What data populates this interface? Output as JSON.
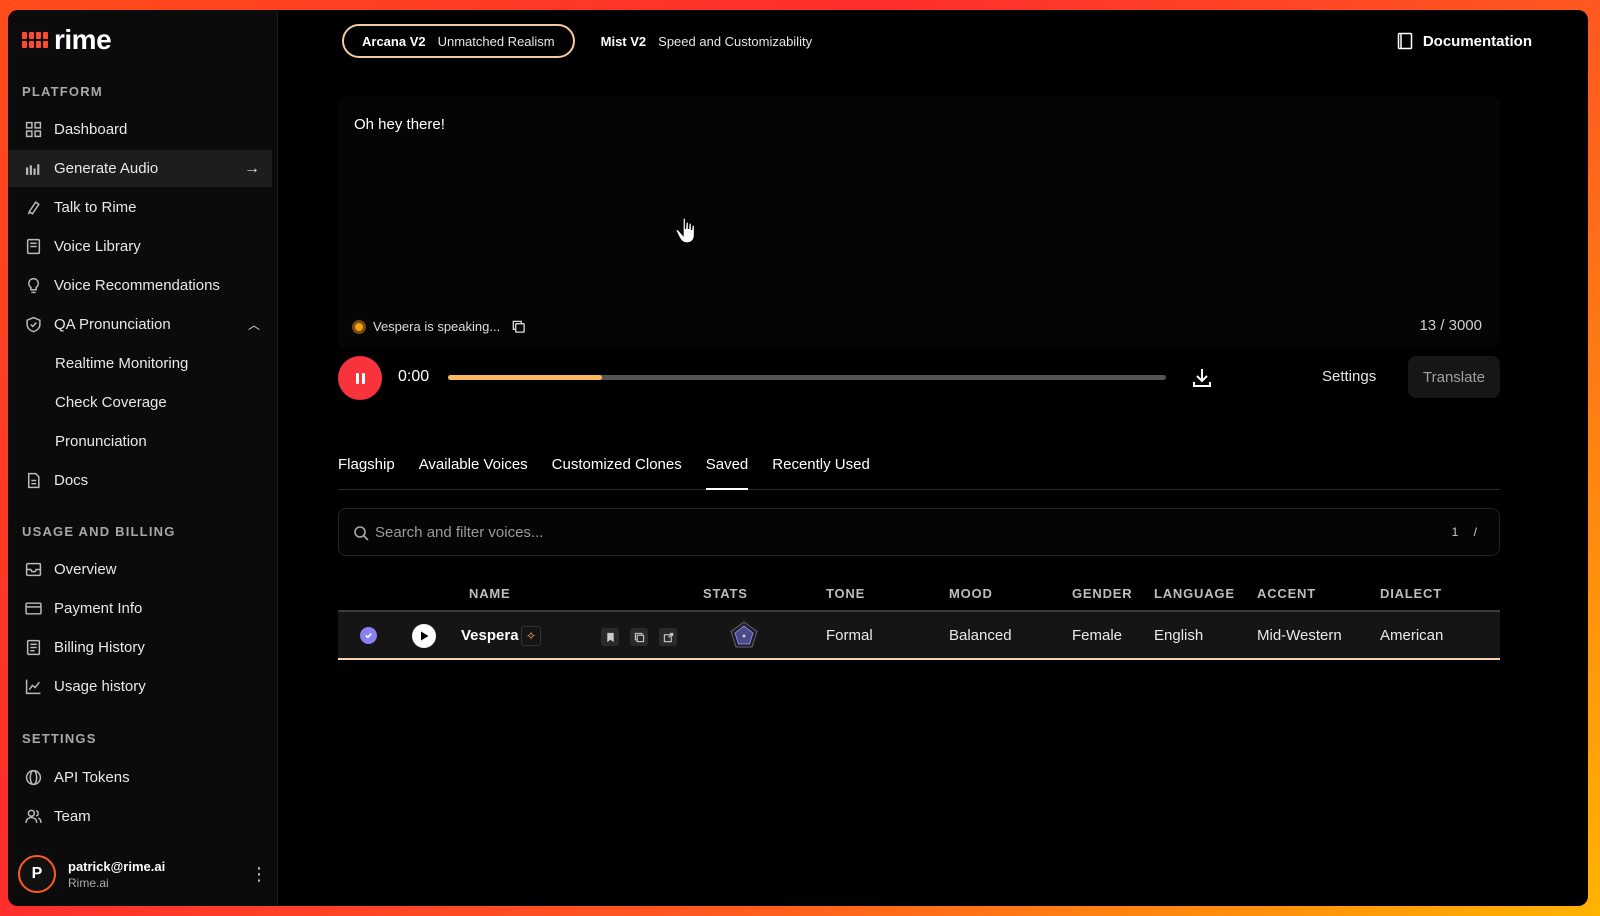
{
  "brand": {
    "name": "rime"
  },
  "sidebar": {
    "sections": [
      {
        "title": "PLATFORM"
      },
      {
        "title": "USAGE AND BILLING"
      },
      {
        "title": "SETTINGS"
      }
    ],
    "items": [
      {
        "label": "Dashboard",
        "icon": "dashboard-icon"
      },
      {
        "label": "Generate Audio",
        "icon": "audio-bars-icon",
        "active": true
      },
      {
        "label": "Talk to Rime",
        "icon": "microphone-icon"
      },
      {
        "label": "Voice Library",
        "icon": "book-icon"
      },
      {
        "label": "Voice Recommendations",
        "icon": "lightbulb-icon"
      },
      {
        "label": "QA Pronunciation",
        "icon": "shield-check-icon",
        "expanded": true
      },
      {
        "label": "Realtime Monitoring"
      },
      {
        "label": "Check Coverage"
      },
      {
        "label": "Pronunciation"
      },
      {
        "label": "Docs",
        "icon": "document-icon"
      },
      {
        "label": "Overview",
        "icon": "inbox-icon"
      },
      {
        "label": "Payment Info",
        "icon": "credit-card-icon"
      },
      {
        "label": "Billing History",
        "icon": "receipt-icon"
      },
      {
        "label": "Usage history",
        "icon": "line-chart-icon"
      },
      {
        "label": "API Tokens",
        "icon": "token-icon"
      },
      {
        "label": "Team",
        "icon": "users-icon"
      }
    ]
  },
  "user": {
    "initial": "P",
    "email": "patrick@rime.ai",
    "org": "Rime.ai"
  },
  "models": [
    {
      "name": "Arcana V2",
      "tagline": "Unmatched Realism",
      "active": true
    },
    {
      "name": "Mist V2",
      "tagline": "Speed and Customizability"
    }
  ],
  "header": {
    "documentation": "Documentation"
  },
  "editor": {
    "text": "Oh hey there!",
    "status": "Vespera is speaking...",
    "char_count": "13 / 3000"
  },
  "player": {
    "time": "0:00",
    "progress": 0.215,
    "settings": "Settings",
    "translate": "Translate"
  },
  "voice_tabs": [
    "Flagship",
    "Available Voices",
    "Customized Clones",
    "Saved",
    "Recently Used"
  ],
  "active_voice_tab": "Saved",
  "search": {
    "placeholder": "Search and filter voices...",
    "shortcut": "1 /"
  },
  "table": {
    "columns": [
      "NAME",
      "STATS",
      "TONE",
      "MOOD",
      "GENDER",
      "LANGUAGE",
      "ACCENT",
      "DIALECT"
    ],
    "rows": [
      {
        "selected": true,
        "name": "Vespera",
        "tone": "Formal",
        "mood": "Balanced",
        "gender": "Female",
        "language": "English",
        "accent": "Mid-Western",
        "dialect": "American"
      }
    ]
  },
  "colors": {
    "accent": "#f8333c",
    "progress": "#fbb860",
    "check": "#8a80f0"
  }
}
